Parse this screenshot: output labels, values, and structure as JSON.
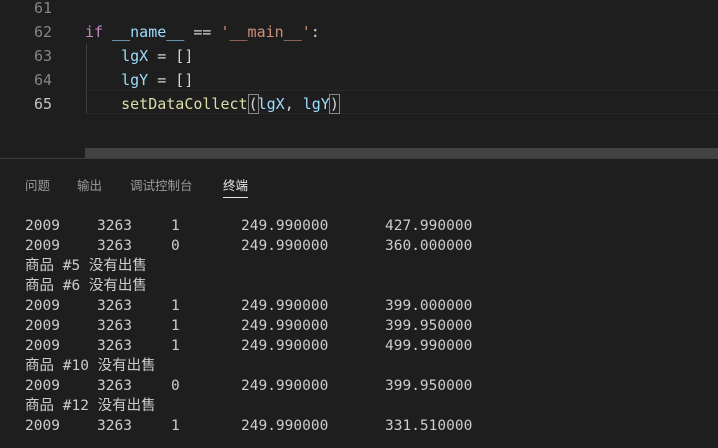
{
  "editor": {
    "lines": [
      {
        "num": "61",
        "tokens": []
      },
      {
        "num": "62",
        "tokens": [
          {
            "t": "if ",
            "c": "kw"
          },
          {
            "t": "__name__",
            "c": "var"
          },
          {
            "t": " == ",
            "c": "op"
          },
          {
            "t": "'__main__'",
            "c": "str"
          },
          {
            "t": ":",
            "c": "op"
          }
        ]
      },
      {
        "num": "63",
        "tokens": [
          {
            "t": "    ",
            "c": "op"
          },
          {
            "t": "lgX",
            "c": "var"
          },
          {
            "t": " = []",
            "c": "op"
          }
        ]
      },
      {
        "num": "64",
        "tokens": [
          {
            "t": "    ",
            "c": "op"
          },
          {
            "t": "lgY",
            "c": "var"
          },
          {
            "t": " = []",
            "c": "op"
          }
        ]
      },
      {
        "num": "65",
        "tokens": [
          {
            "t": "    ",
            "c": "op"
          },
          {
            "t": "setDataCollect",
            "c": "fn"
          },
          {
            "t": "(",
            "c": "op bracket"
          },
          {
            "t": "lgX",
            "c": "var"
          },
          {
            "t": ", ",
            "c": "op"
          },
          {
            "t": "lgY",
            "c": "var"
          },
          {
            "t": ")",
            "c": "op bracket"
          }
        ]
      }
    ]
  },
  "panel": {
    "tabs": [
      "问题",
      "输出",
      "调试控制台",
      "终端"
    ],
    "active_tab": "终端",
    "terminal_rows": [
      [
        "2009",
        "3263",
        "1",
        "249.990000",
        "427.990000"
      ],
      [
        "2009",
        "3263",
        "0",
        "249.990000",
        "360.000000"
      ],
      [
        "商品 #5 没有出售"
      ],
      [
        "商品 #6 没有出售"
      ],
      [
        "2009",
        "3263",
        "1",
        "249.990000",
        "399.000000"
      ],
      [
        "2009",
        "3263",
        "1",
        "249.990000",
        "399.950000"
      ],
      [
        "2009",
        "3263",
        "1",
        "249.990000",
        "499.990000"
      ],
      [
        "商品 #10 没有出售"
      ],
      [
        "2009",
        "3263",
        "0",
        "249.990000",
        "399.950000"
      ],
      [
        "商品 #12 没有出售"
      ],
      [
        "2009",
        "3263",
        "1",
        "249.990000",
        "331.510000"
      ]
    ]
  }
}
